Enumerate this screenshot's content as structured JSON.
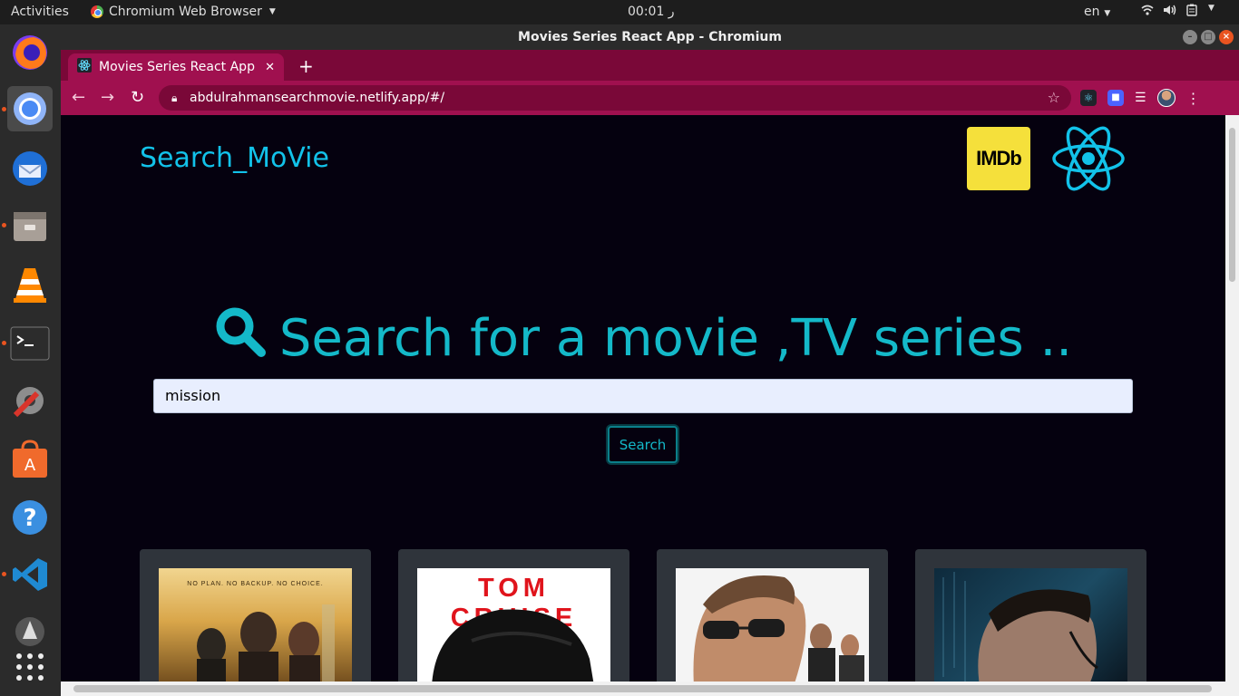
{
  "system": {
    "activities": "Activities",
    "app_name": "Chromium Web Browser",
    "clock": "ر 00:01",
    "lang": "en"
  },
  "window": {
    "title": "Movies Series React App - Chromium"
  },
  "browser": {
    "tab_title": "Movies Series React App",
    "url": "abdulrahmansearchmovie.netlify.app/#/"
  },
  "page": {
    "brand": "Search_MoVie",
    "imdb_logo": "IMDb",
    "hero_title": "Search for a movie ,TV series ..",
    "search_value": "mission",
    "search_button": "Search",
    "accent_color": "#14b9c9",
    "brand_color": "#12c2e9",
    "background_color": "#05010f",
    "posters": [
      {
        "text_top": "NO PLAN. NO BACKUP. NO CHOICE."
      },
      {
        "text_top": "TOM CRUISE"
      },
      {
        "text_top": ""
      },
      {
        "text_top": ""
      }
    ]
  },
  "dock": {
    "items": [
      "firefox-icon",
      "chromium-icon",
      "thunderbird-icon",
      "files-icon",
      "vlc-icon",
      "terminal-icon",
      "settings-icon",
      "software-icon",
      "help-icon",
      "vscode-icon",
      "updater-icon",
      "show-apps-icon"
    ]
  }
}
